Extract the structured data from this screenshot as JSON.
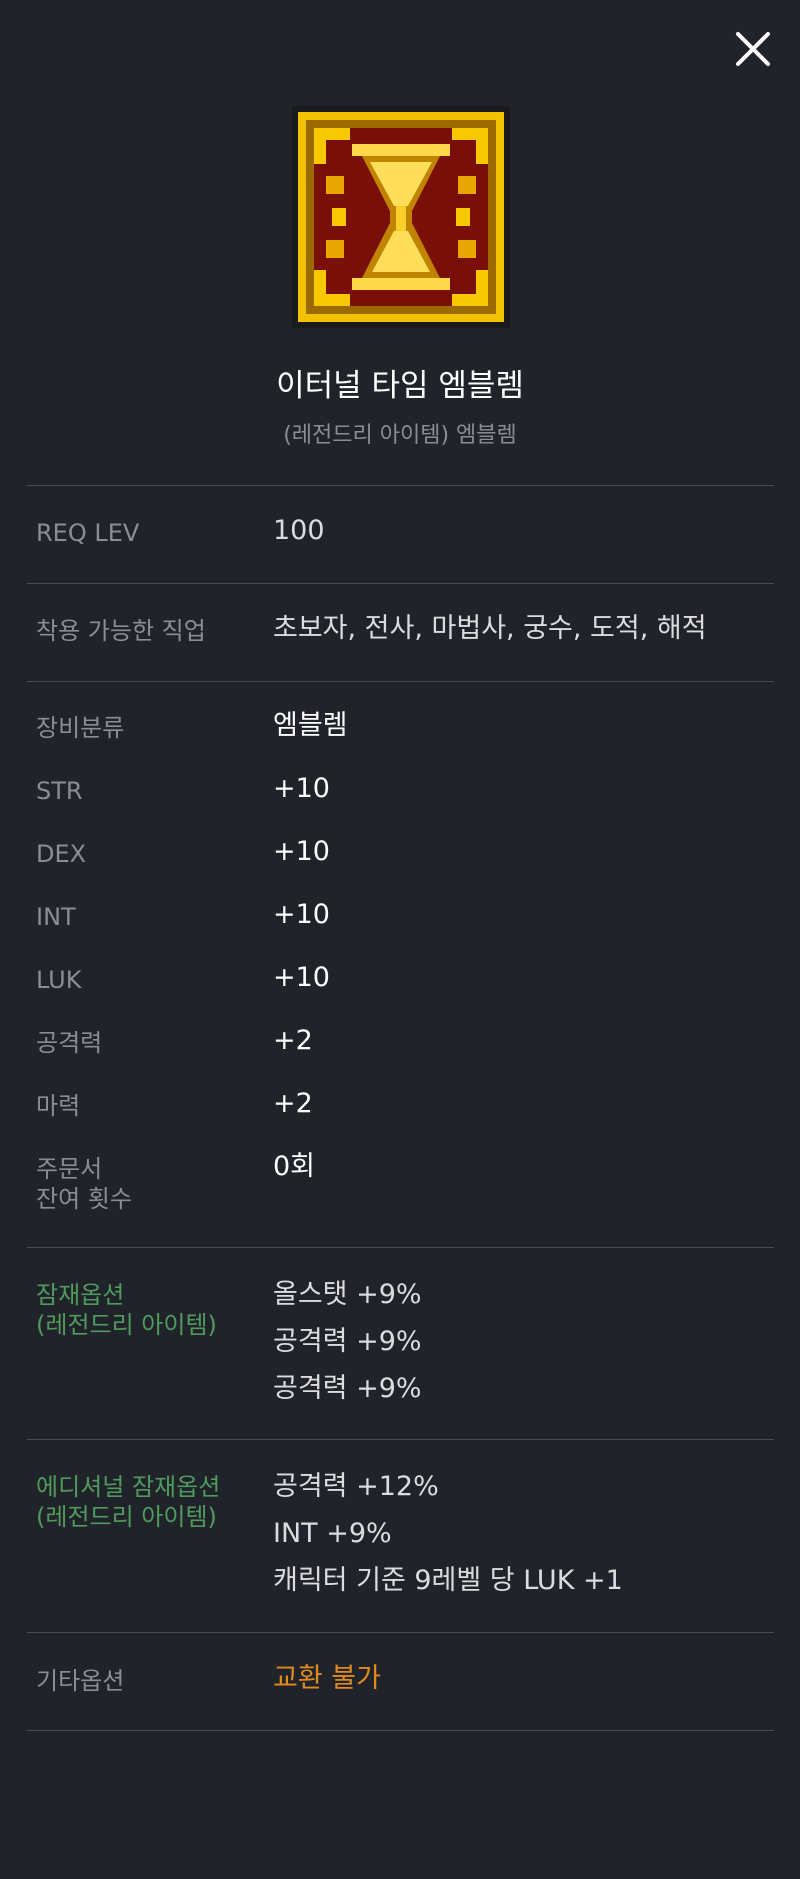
{
  "close": {
    "icon": "close-icon"
  },
  "item": {
    "name": "이터널 타임 엠블렘",
    "subtitle": "(레전드리 아이템) 엠블렘",
    "icon": "hourglass-emblem-icon"
  },
  "req": {
    "label": "REQ LEV",
    "value": "100"
  },
  "jobs": {
    "label": "착용 가능한 직업",
    "value": "초보자, 전사, 마법사, 궁수, 도적, 해적"
  },
  "stats": [
    {
      "label": "장비분류",
      "value": "엠블렘"
    },
    {
      "label": "STR",
      "value": "+10"
    },
    {
      "label": "DEX",
      "value": "+10"
    },
    {
      "label": "INT",
      "value": "+10"
    },
    {
      "label": "LUK",
      "value": "+10"
    },
    {
      "label": "공격력",
      "value": "+2"
    },
    {
      "label": "마력",
      "value": "+2"
    },
    {
      "label": "주문서\n잔여 횟수",
      "value": "0회"
    }
  ],
  "potential": {
    "label": "잠재옵션\n(레전드리 아이템)",
    "lines": [
      "올스탯 +9%",
      "공격력 +9%",
      "공격력 +9%"
    ]
  },
  "additional": {
    "label": "에디셔널 잠재옵션\n(레전드리 아이템)",
    "lines": [
      "공격력 +12%",
      "INT +9%",
      "캐릭터 기준 9레벨 당 LUK +1"
    ]
  },
  "etc": {
    "label": "기타옵션",
    "value": "교환 불가"
  },
  "colors": {
    "background": "#21232a",
    "potential_green": "#4f9a5c",
    "etc_orange": "#e08a1e",
    "label_gray": "#8b8d93"
  }
}
